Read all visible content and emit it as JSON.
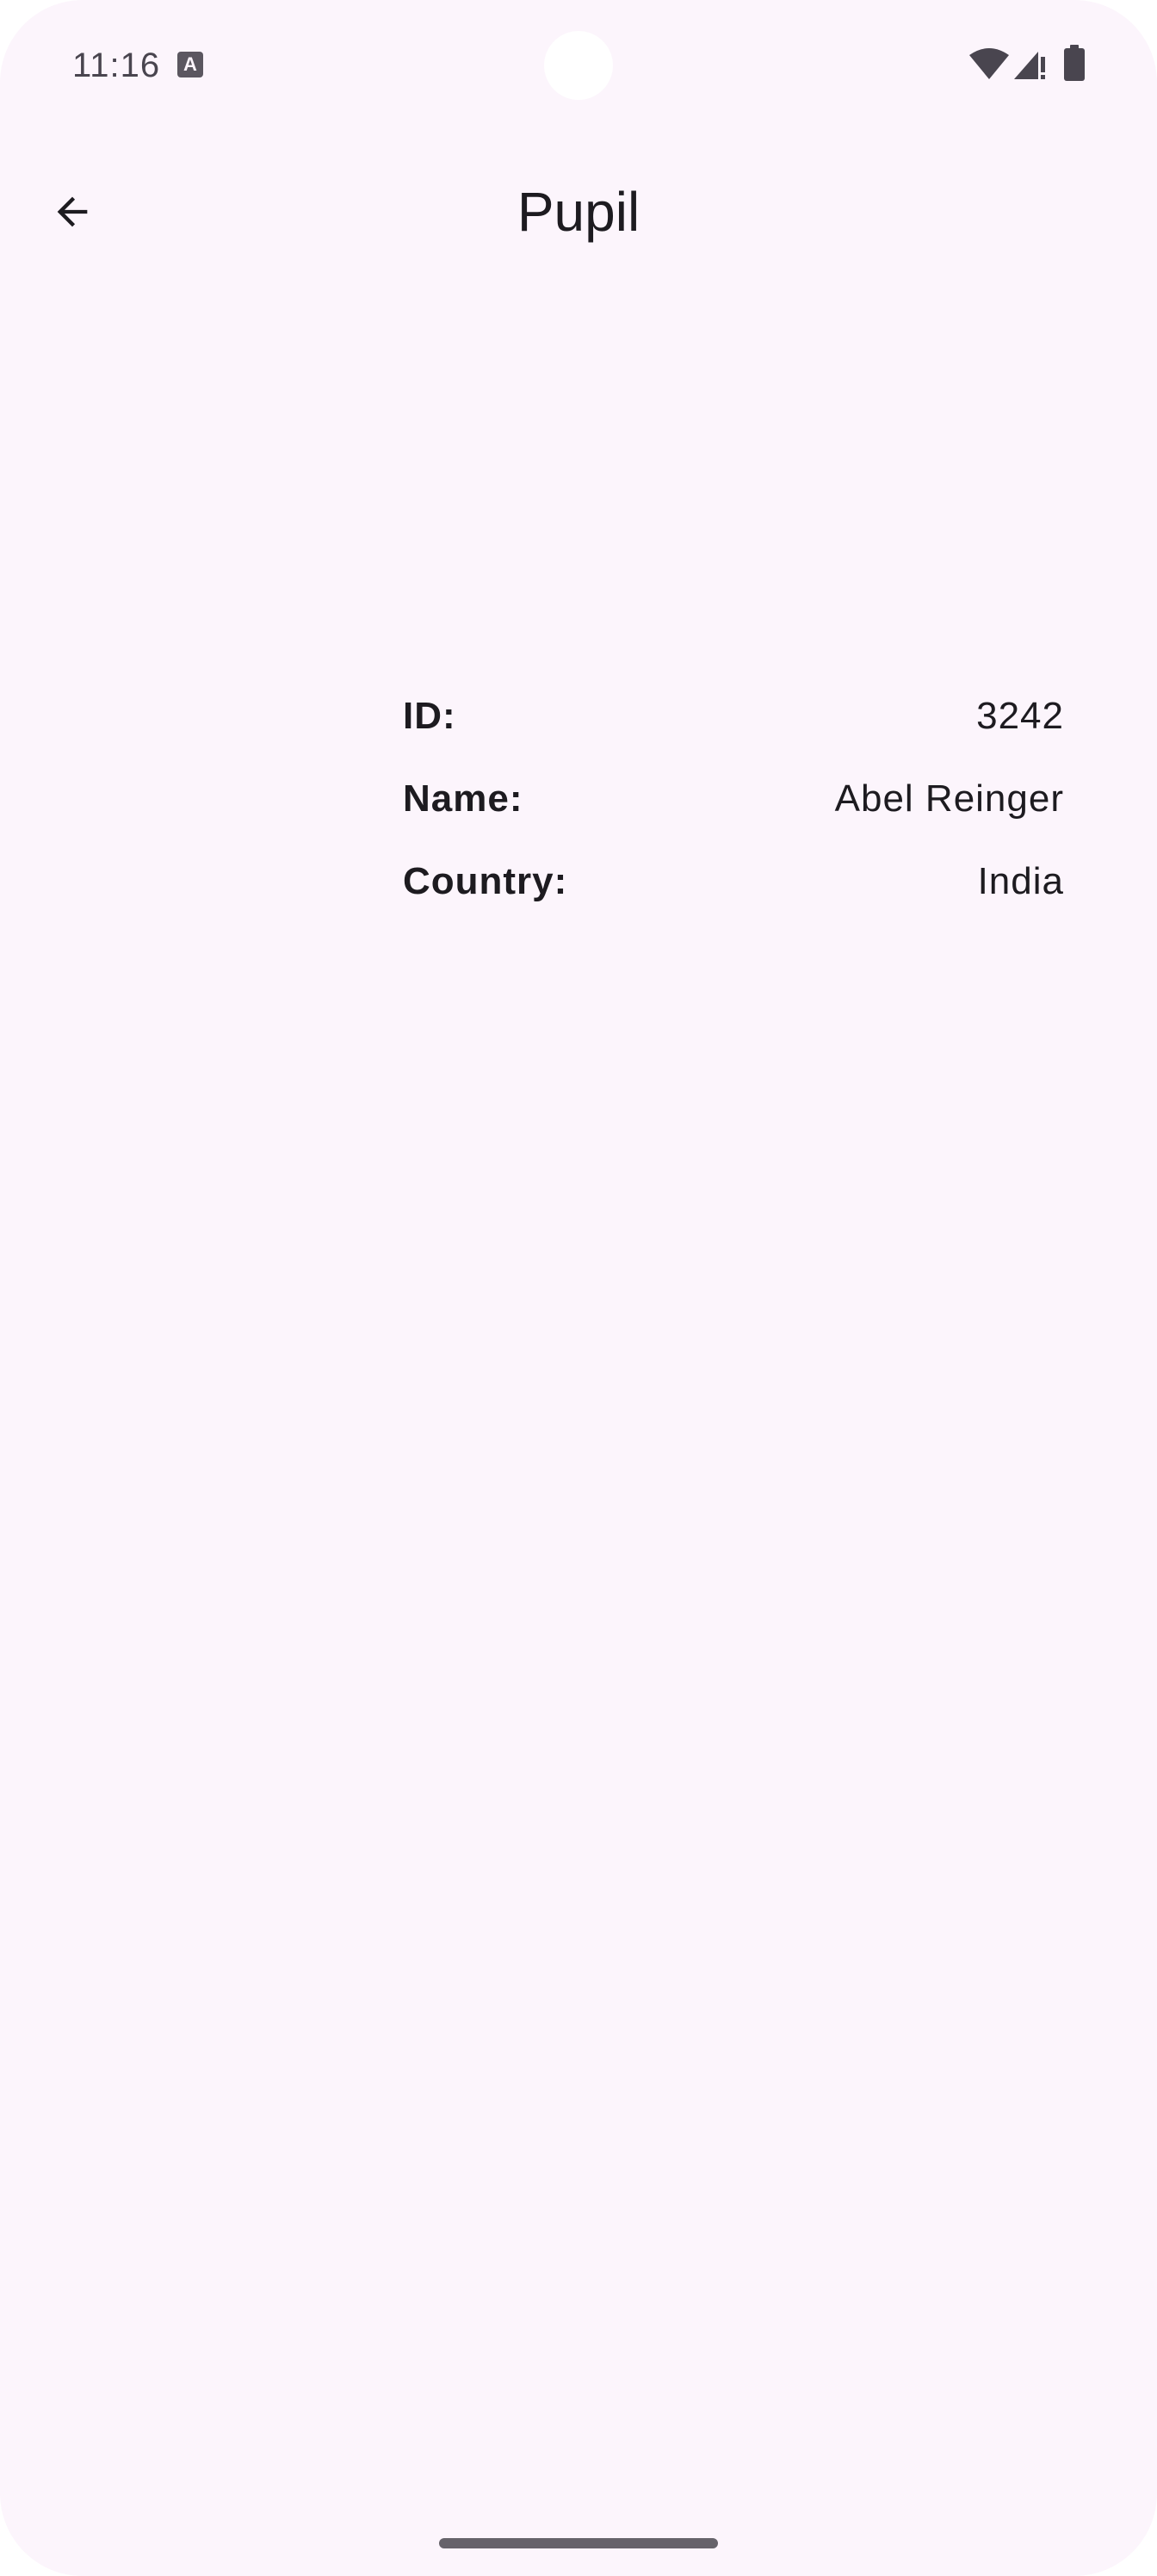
{
  "status_bar": {
    "time": "11:16",
    "notification_icon": "A"
  },
  "app_bar": {
    "title": "Pupil",
    "back_icon": "arrow-back-icon"
  },
  "pupil": {
    "rows": [
      {
        "label": "ID:",
        "value": "3242"
      },
      {
        "label": "Name:",
        "value": "Abel Reinger"
      },
      {
        "label": "Country:",
        "value": "India"
      }
    ]
  },
  "colors": {
    "background": "#fcf5fc",
    "text": "#1d1b20",
    "status_icons": "#49454f"
  }
}
